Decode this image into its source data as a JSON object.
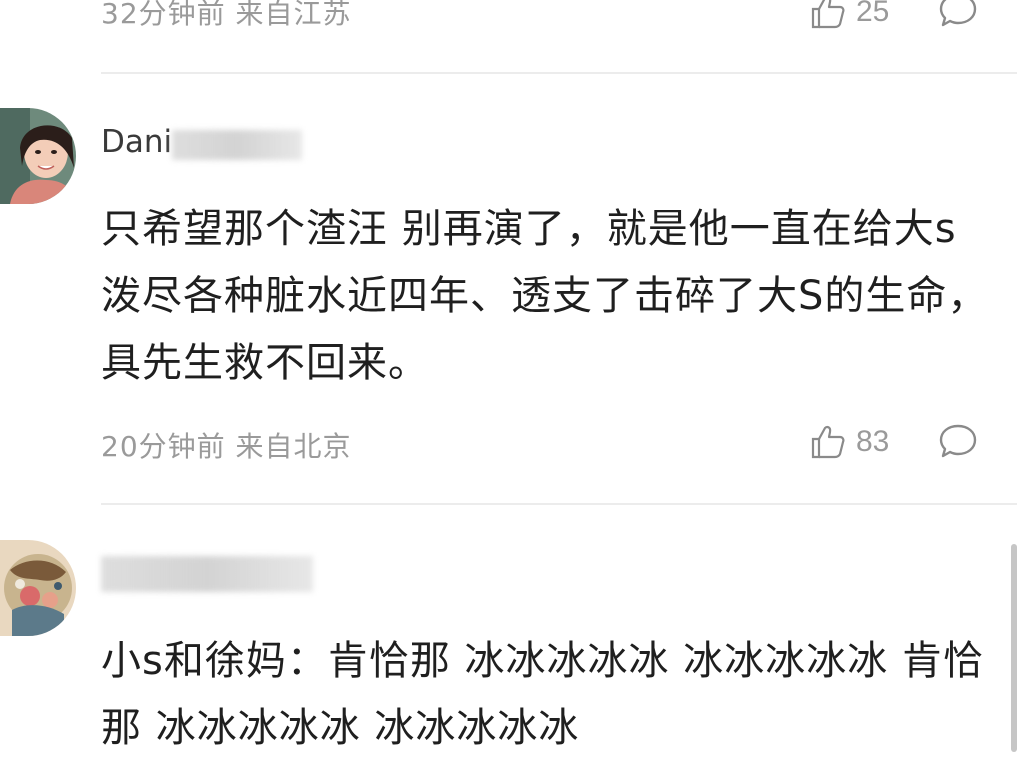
{
  "comments": [
    {
      "meta": "32分钟前 来自江苏",
      "likes": "25"
    },
    {
      "username": "Dani",
      "body": "只希望那个渣汪 别再演了，就是他一直在给大s泼尽各种脏水近四年、透支了击碎了大S的生命，具先生救不回来。",
      "meta": "20分钟前 来自北京",
      "likes": "83"
    },
    {
      "username": "",
      "body": "小s和徐妈：肯恰那 冰冰冰冰冰 冰冰冰冰冰 肯恰那 冰冰冰冰冰 冰冰冰冰冰"
    }
  ],
  "icons": {
    "like": "thumbs-up-icon",
    "reply": "comment-bubble-icon"
  },
  "colors": {
    "meta_text": "#9a9a9a",
    "divider": "#ececec",
    "body_text": "#1f1f1f"
  }
}
